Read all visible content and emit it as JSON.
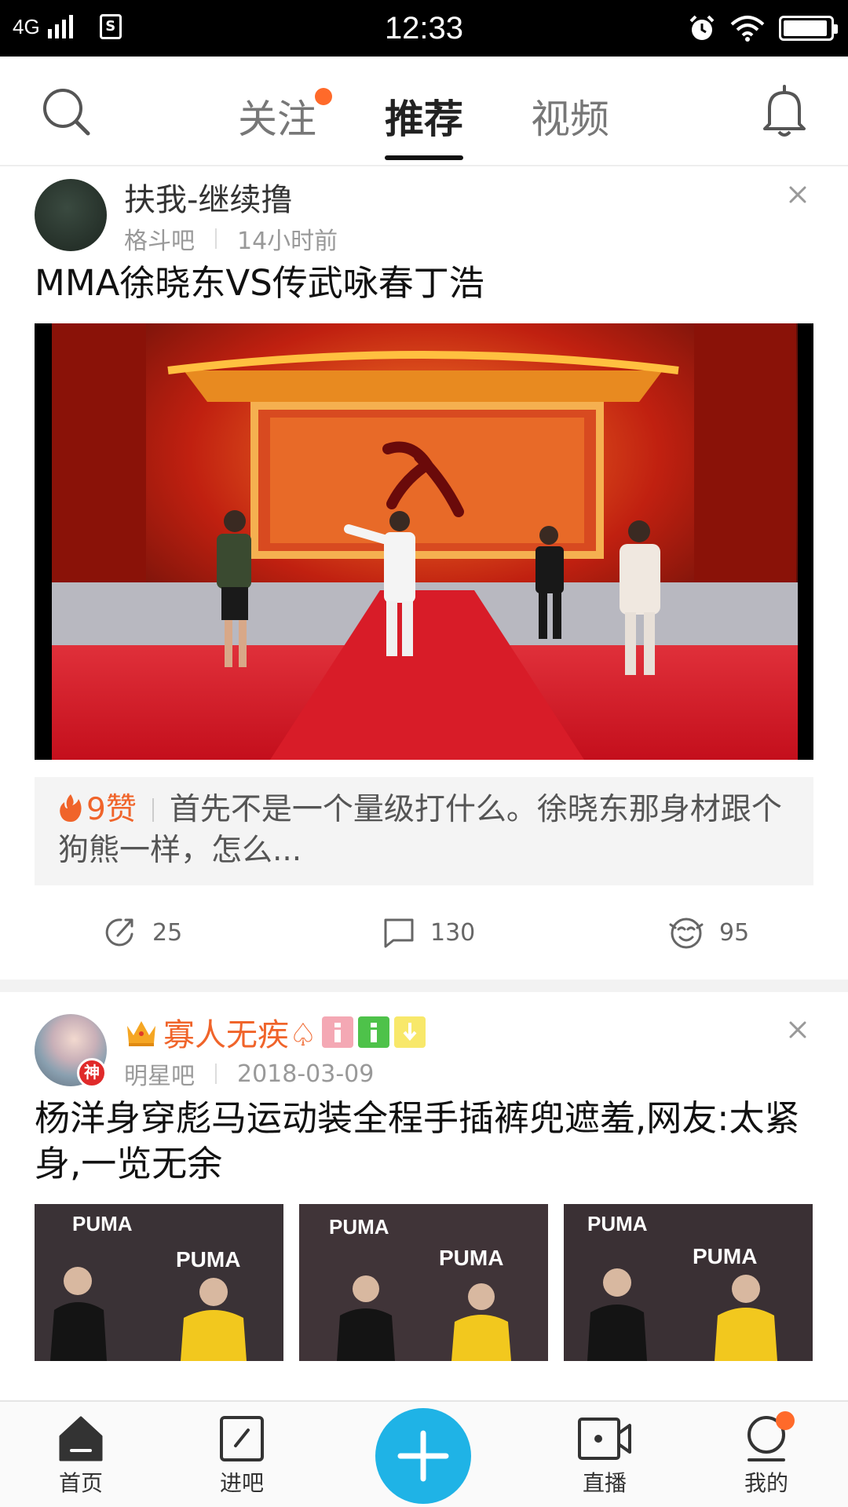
{
  "status_bar": {
    "network": "4G",
    "time": "12:33",
    "sim_icon": "S",
    "battery_level": 0.95
  },
  "top_nav": {
    "tabs": [
      {
        "label": "关注",
        "has_dot": true
      },
      {
        "label": "推荐",
        "active": true
      },
      {
        "label": "视频"
      }
    ],
    "accent_color": "#ff6a2a"
  },
  "posts": [
    {
      "author": "扶我-继续撸",
      "forum": "格斗吧",
      "time": "14小时前",
      "title": "MMA徐晓东VS传武咏春丁浩",
      "hot_comment": {
        "likes": "9赞",
        "text": "首先不是一个量级打什么。徐晓东那身材跟个狗熊一样，怎么..."
      },
      "actions": {
        "share": "25",
        "comment": "130",
        "like": "95"
      }
    },
    {
      "author": "寡人无疾♤",
      "forum": "明星吧",
      "time": "2018-03-09",
      "avatar_badge": "神",
      "title": "杨洋身穿彪马运动装全程手插裤兜遮羞,网友:太紧身,一览无余",
      "thumb_brand": "PUMA"
    }
  ],
  "bottom_bar": {
    "items": [
      {
        "label": "首页"
      },
      {
        "label": "进吧"
      },
      {
        "label": "直播"
      },
      {
        "label": "我的"
      }
    ],
    "plus_color": "#1fb3e6"
  }
}
